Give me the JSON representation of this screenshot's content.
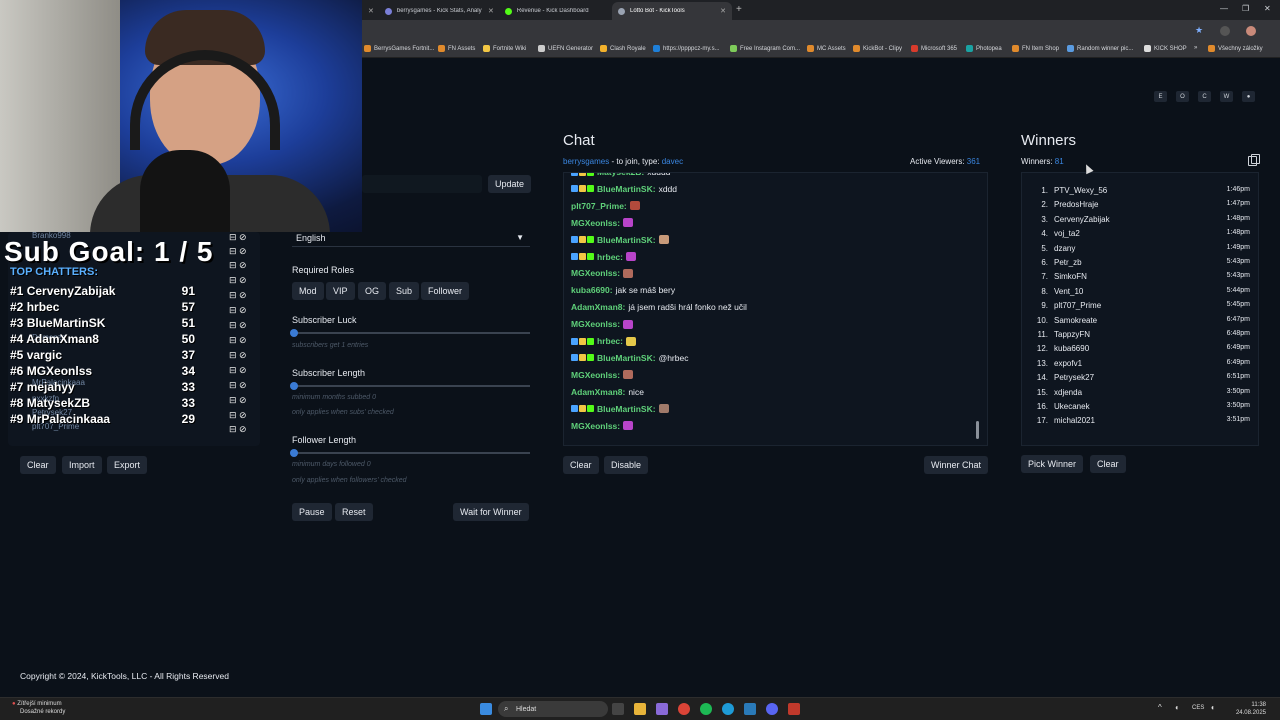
{
  "browser": {
    "tabs": [
      {
        "title": "berrysgames - Kick Stats, Analy"
      },
      {
        "title": "Revenue - Kick Dashboard"
      },
      {
        "title": "Lotto Bot - KickTools"
      }
    ],
    "bookmarks": [
      "BerrysGames Fortnit...",
      "FN Assets",
      "Fortnite Wiki",
      "UEFN Generator",
      "Clash Royale",
      "https://ppppcz-my.s...",
      "Free Instagram Com...",
      "MC Assets",
      "KickBot - Clipy",
      "Microsoft 365",
      "Photopea",
      "FN Item Shop",
      "Random winner pic...",
      "KICK SHOP"
    ],
    "all_bookmarks": "Všechny záložky"
  },
  "overlay": {
    "sub_goal": "Sub Goal:  1 / 5",
    "top_chatters_title": "TOP CHATTERS:",
    "top_chatters": [
      {
        "rank": "#1",
        "name": "CervenyZabijak",
        "count": "91"
      },
      {
        "rank": "#2",
        "name": "hrbec",
        "count": "57"
      },
      {
        "rank": "#3",
        "name": "BlueMartinSK",
        "count": "51"
      },
      {
        "rank": "#4",
        "name": "AdamXman8",
        "count": "50"
      },
      {
        "rank": "#5",
        "name": "vargic",
        "count": "37"
      },
      {
        "rank": "#6",
        "name": "MGXeonlss",
        "count": "34"
      },
      {
        "rank": "#7",
        "name": "mejahyy",
        "count": "33"
      },
      {
        "rank": "#8",
        "name": "MatysekZB",
        "count": "33"
      },
      {
        "rank": "#9",
        "name": "MrPalacinkaaa",
        "count": "29"
      }
    ],
    "ghost_users": [
      "Branko998",
      "Domenzs",
      "MrPalacinkaaa",
      "pxxkzfn",
      "Petrysek27",
      "plt707_Prime"
    ]
  },
  "left_panel": {
    "buttons": {
      "clear": "Clear",
      "import": "Import",
      "export": "Export"
    }
  },
  "settings": {
    "update_button": "Update",
    "language": "English",
    "required_roles_label": "Required Roles",
    "roles": [
      "Mod",
      "VIP",
      "OG",
      "Sub",
      "Follower"
    ],
    "subscriber_luck": {
      "label": "Subscriber Luck",
      "hint": "subscribers get 1 entries",
      "value": 0.0
    },
    "subscriber_length": {
      "label": "Subscriber Length",
      "hint1": "minimum months subbed 0",
      "hint2": "only applies when subs' checked",
      "value": 0.0
    },
    "follower_length": {
      "label": "Follower Length",
      "hint1": "minimum days followed 0",
      "hint2": "only applies when followers' checked",
      "value": 0.0
    },
    "pause": "Pause",
    "reset": "Reset",
    "wait_for_winner": "Wait for Winner"
  },
  "chat": {
    "title": "Chat",
    "channel": "berrysgames",
    "join_text": " - to join, type: ",
    "keyword": "davec",
    "viewers_label": "Active Viewers: ",
    "viewers": "361",
    "messages": [
      {
        "user": "Matysek2B:",
        "text": "xdddd",
        "badges": true
      },
      {
        "user": "BlueMartinSK:",
        "text": "xddd",
        "badges": true
      },
      {
        "user": "plt707_Prime:",
        "text": "",
        "emote": "#b24a3c"
      },
      {
        "user": "MGXeonlss:",
        "text": "",
        "emote": "#b844c9"
      },
      {
        "user": "BlueMartinSK:",
        "text": "",
        "badges": true,
        "emote": "#c89a7a"
      },
      {
        "user": "hrbec:",
        "text": "",
        "badges": true,
        "emote": "#b844c9"
      },
      {
        "user": "MGXeonlss:",
        "text": "",
        "emote": "#b06a5c"
      },
      {
        "user": "kuba6690:",
        "text": "jak se máš bery"
      },
      {
        "user": "AdamXman8:",
        "text": "já jsem radši hrál fonko než učil"
      },
      {
        "user": "MGXeonlss:",
        "text": "",
        "emote": "#b844c9"
      },
      {
        "user": "hrbec:",
        "text": "",
        "badges": true,
        "emote": "#e5c84a"
      },
      {
        "user": "BlueMartinSK:",
        "text": "@hrbec",
        "badges": true
      },
      {
        "user": "MGXeonlss:",
        "text": "",
        "emote": "#b06a5c"
      },
      {
        "user": "AdamXman8:",
        "text": "nice"
      },
      {
        "user": "BlueMartinSK:",
        "text": "",
        "badges": true,
        "emote": "#a07a6a"
      },
      {
        "user": "MGXeonlss:",
        "text": "",
        "emote": "#b844c9"
      }
    ],
    "buttons": {
      "clear": "Clear",
      "disable": "Disable",
      "winner_chat": "Winner Chat"
    }
  },
  "winners": {
    "title": "Winners",
    "count_label": "Winners: ",
    "count": "81",
    "list": [
      {
        "n": "1.",
        "name": "PTV_Wexy_56",
        "time": "1:46pm"
      },
      {
        "n": "2.",
        "name": "PredosHraje",
        "time": "1:47pm"
      },
      {
        "n": "3.",
        "name": "CervenyZabijak",
        "time": "1:48pm"
      },
      {
        "n": "4.",
        "name": "voj_ta2",
        "time": "1:48pm"
      },
      {
        "n": "5.",
        "name": "dzany",
        "time": "1:49pm"
      },
      {
        "n": "6.",
        "name": "Petr_zb",
        "time": "5:43pm"
      },
      {
        "n": "7.",
        "name": "SimkoFN",
        "time": "5:43pm"
      },
      {
        "n": "8.",
        "name": "Vent_10",
        "time": "5:44pm"
      },
      {
        "n": "9.",
        "name": "plt707_Prime",
        "time": "5:45pm"
      },
      {
        "n": "10.",
        "name": "Samokreate",
        "time": "6:47pm"
      },
      {
        "n": "11.",
        "name": "TappzyFN",
        "time": "6:48pm"
      },
      {
        "n": "12.",
        "name": "kuba6690",
        "time": "6:49pm"
      },
      {
        "n": "13.",
        "name": "expofv1",
        "time": "6:49pm"
      },
      {
        "n": "14.",
        "name": "Petrysek27",
        "time": "6:51pm"
      },
      {
        "n": "15.",
        "name": "xdjenda",
        "time": "3:50pm"
      },
      {
        "n": "16.",
        "name": "Ukecanek",
        "time": "3:50pm"
      },
      {
        "n": "17.",
        "name": "michal2021",
        "time": "3:51pm"
      }
    ],
    "buttons": {
      "pick": "Pick Winner",
      "clear": "Clear"
    }
  },
  "top_pills": [
    "E",
    "O",
    "C",
    "W",
    "●"
  ],
  "footer": "Copyright © 2024, KickTools, LLC - All Rights Reserved",
  "taskbar": {
    "weather_line1": "Zítřejší minimum",
    "weather_line2": "Dosažné rekordy",
    "search": "Hledat",
    "lang": "CES",
    "time": "11:38",
    "date": "24.08.2025"
  },
  "colors": {
    "accent": "#3a86e0",
    "chat_user": "#5fd17a",
    "bg": "#0b1119",
    "panel": "#0e151f"
  }
}
